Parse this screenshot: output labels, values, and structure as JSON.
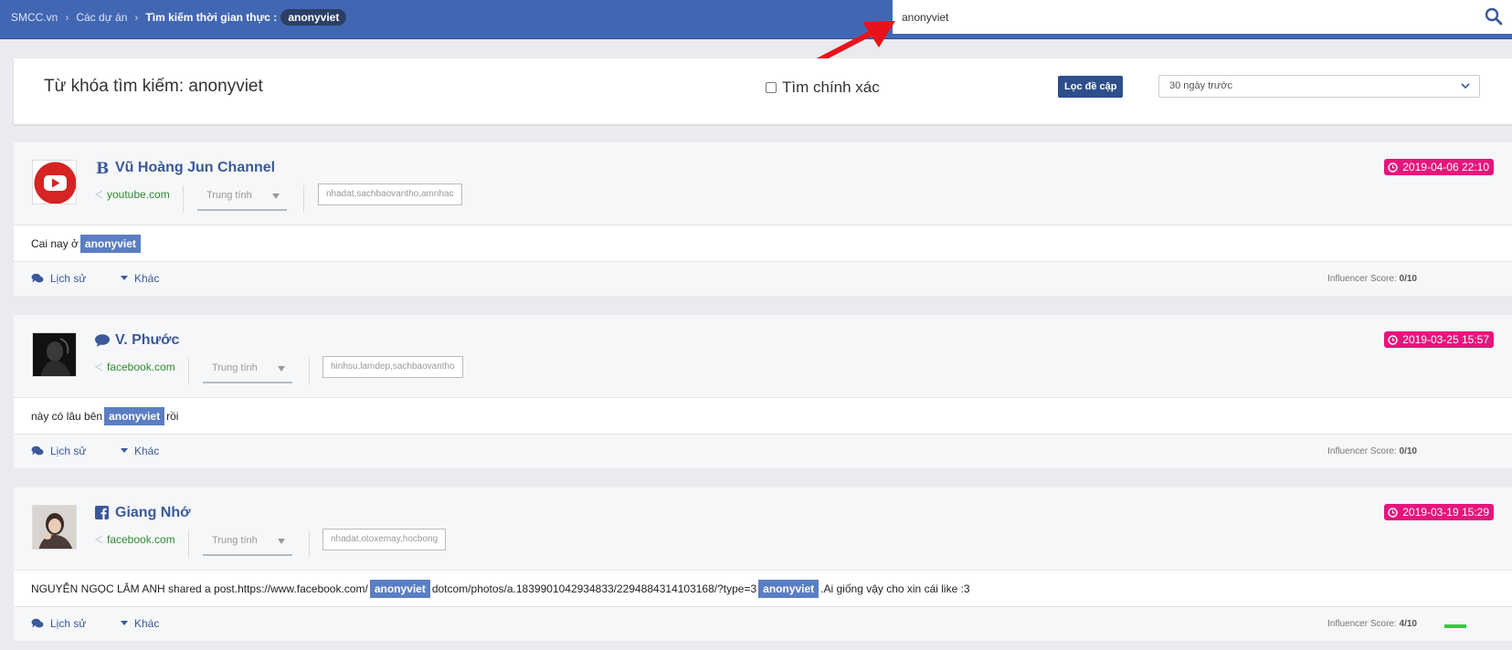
{
  "header": {
    "breadcrumb": {
      "home": "SMCC.vn",
      "projects": "Các dự án",
      "current": "Tìm kiếm thời gian thực :",
      "keyword_badge": "anonyviet",
      "separator": "›"
    },
    "search": {
      "value": "anonyviet",
      "icon": "search-icon"
    }
  },
  "filter": {
    "keyword_label": "Từ khóa tìm kiếm: anonyviet",
    "exact_label": "Tìm chính xác",
    "exact_checked": false,
    "filter_button": "Lọc đề cập",
    "time_range": "30 ngày trước"
  },
  "posts": [
    {
      "author": "Vũ Hoàng Jun Channel",
      "source_icon": "blogger-b-icon",
      "domain": "youtube.com",
      "sentiment": "Trung tính",
      "tags": "nhadat,sachbaovantho,amnhac",
      "date": "2019-04-06 22:10",
      "content": {
        "pre": "Cai nay ở",
        "kw1": "anonyviet"
      },
      "history_label": "Lịch sử",
      "more_label": "Khác",
      "score_label": "Influencer Score:",
      "score": "0/10",
      "score_fraction": 0
    },
    {
      "author": "V. Phước",
      "source_icon": "comment-icon",
      "domain": "facebook.com",
      "sentiment": "Trung tính",
      "tags": "hinhsu,lamdep,sachbaovantho",
      "date": "2019-03-25 15:57",
      "content": {
        "pre": "này có lâu bên",
        "kw1": "anonyviet",
        "post": "rồi"
      },
      "history_label": "Lịch sử",
      "more_label": "Khác",
      "score_label": "Influencer Score:",
      "score": "0/10",
      "score_fraction": 0
    },
    {
      "author": "Giang Nhớ",
      "source_icon": "facebook-icon",
      "domain": "facebook.com",
      "sentiment": "Trung tính",
      "tags": "nhadat,otoxemay,hocbong",
      "date": "2019-03-19 15:29",
      "content": {
        "pre": "NGUYỄN NGỌC LÂM ANH shared a post.https://www.facebook.com/",
        "kw1": "anonyviet",
        "mid": "dotcom/photos/a.1839901042934833/2294884314103168/?type=3",
        "kw2": "anonyviet",
        "post": ".Ai giống vậy cho xin cái like :3"
      },
      "history_label": "Lịch sử",
      "more_label": "Khác",
      "score_label": "Influencer Score:",
      "score": "4/10",
      "score_fraction": 0.4
    }
  ]
}
